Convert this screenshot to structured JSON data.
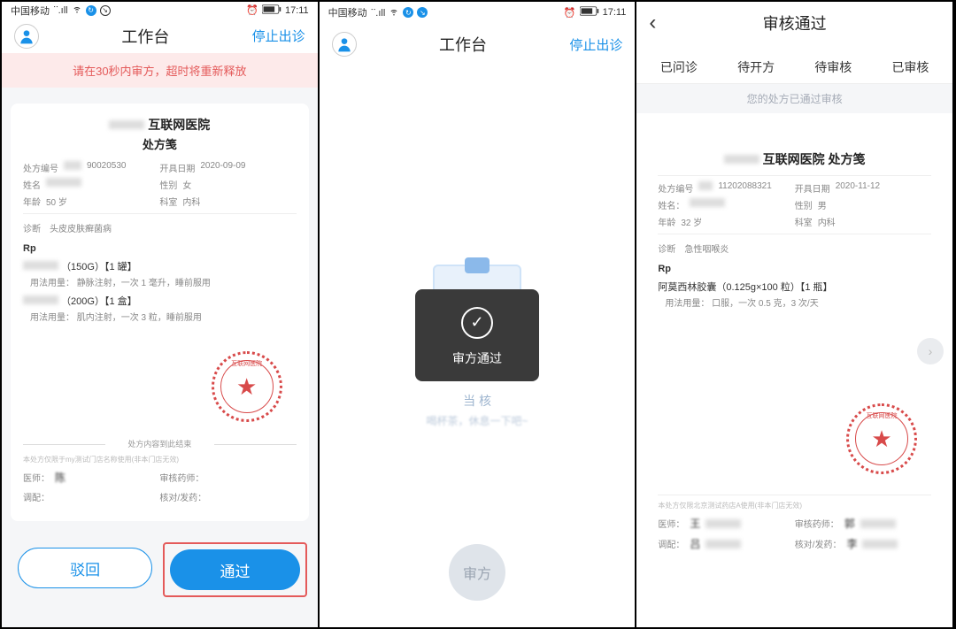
{
  "status": {
    "carrier": "中国移动",
    "time": "17:11"
  },
  "screen1": {
    "header": {
      "title": "工作台",
      "action": "停止出诊"
    },
    "warning": "请在30秒内审方，超时将重新释放",
    "rx": {
      "hospital": "互联网医院",
      "title": "处方笺",
      "id_label": "处方编号",
      "id_value": "90020530",
      "date_label": "开具日期",
      "date_value": "2020-09-09",
      "name_label": "姓名",
      "sex_label": "性别",
      "sex_value": "女",
      "age_label": "年龄",
      "age_value": "50 岁",
      "dept_label": "科室",
      "dept_value": "内科",
      "diag_label": "诊断",
      "diag_value": "头皮皮肤癣菌病",
      "rp": "Rp",
      "meds": [
        {
          "name": "（150G）【1 罐】",
          "usage": "用法用量：  静脉注射，一次 1 毫升，睡前服用"
        },
        {
          "name": "（200G）【1 盒】",
          "usage": "用法用量：  肌内注射，一次 3 粒，睡前服用"
        }
      ],
      "end": "处方内容到此结束",
      "note": "本处方仅限于my测试门店名称使用(非本门店无效)",
      "doctor_label": "医师：",
      "doctor_value": "陈",
      "pharm_label": "审核药师：",
      "tiaoji_label": "调配：",
      "hedui_label": "核对/发药："
    },
    "reject_label": "驳回",
    "approve_label": "通过"
  },
  "screen2": {
    "header": {
      "title": "工作台",
      "action": "停止出诊"
    },
    "toast": "审方通过",
    "sub1": "当                                核",
    "sub2": "喝杯茶，休息一下吧~",
    "review_btn": "审方"
  },
  "screen3": {
    "title": "审核通过",
    "tabs": [
      "已问诊",
      "待开方",
      "待审核",
      "已审核"
    ],
    "banner": "您的处方已通过审核",
    "rx": {
      "hospital_line": "互联网医院 处方笺",
      "id_label": "处方编号",
      "id_value": "11202088321",
      "date_label": "开具日期",
      "date_value": "2020-11-12",
      "name_label": "姓名：",
      "sex_label": "性别",
      "sex_value": "男",
      "age_label": "年龄",
      "age_value": "32 岁",
      "dept_label": "科室",
      "dept_value": "内科",
      "diag_label": "诊断",
      "diag_value": "急性咽喉炎",
      "rp": "Rp",
      "med_name": "阿莫西林胶囊（0.125g×100 粒）【1 瓶】",
      "med_usage": "用法用量：  口服，一次 0.5 克，3 次/天",
      "note": "本处方仅限北京测试药店A使用(非本门店无效)",
      "doctor_label": "医师：",
      "doctor_value": "王",
      "pharm_label": "审核药师：",
      "pharm_value": "郭",
      "tiaoji_label": "调配：",
      "tiaoji_value": "吕",
      "hedui_label": "核对/发药：",
      "hedui_value": "李"
    }
  }
}
